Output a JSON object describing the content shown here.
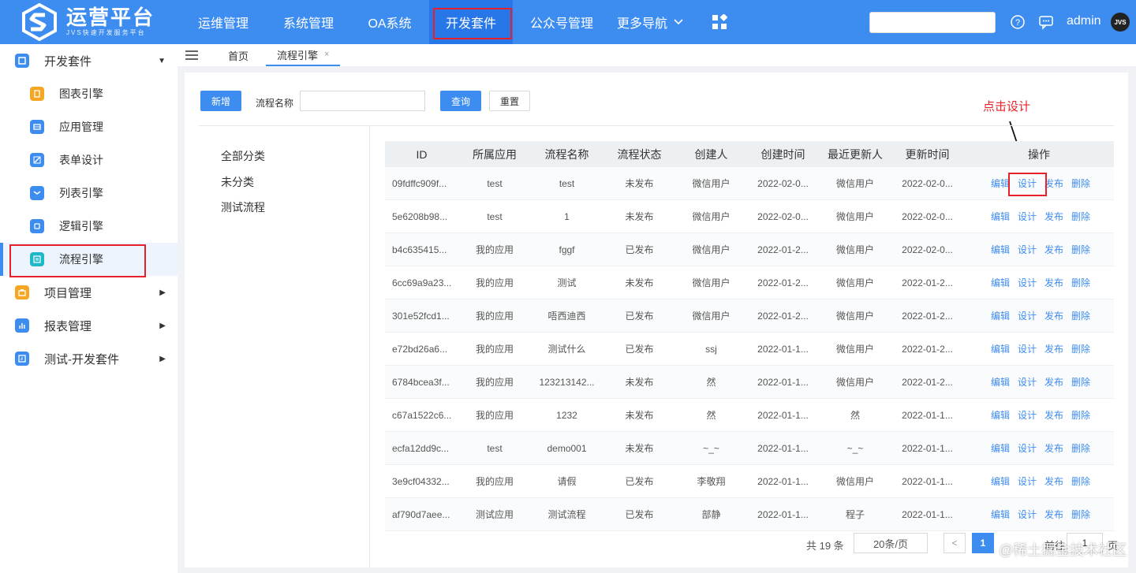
{
  "brand": {
    "title": "运营平台",
    "subtitle": "JVS快速开发服务平台",
    "logo_icon": "hexagon-s-logo"
  },
  "nav": {
    "items": [
      {
        "label": "运维管理"
      },
      {
        "label": "系统管理"
      },
      {
        "label": "OA系统"
      },
      {
        "label": "开发套件",
        "active": true
      },
      {
        "label": "公众号管理"
      },
      {
        "label": "更多导航"
      }
    ],
    "grid_icon": "apps-grid-icon",
    "help_icon": "question-circle-icon",
    "message_icon": "chat-icon",
    "username": "admin",
    "avatar_text": "JVS"
  },
  "sidebar": {
    "items": [
      {
        "label": "开发套件",
        "level": "top",
        "icon": "suite-icon",
        "color": "#3d8cf0",
        "expanded": true
      },
      {
        "label": "图表引擎",
        "level": "sub",
        "icon": "chart-doc-icon",
        "color": "#f5a623"
      },
      {
        "label": "应用管理",
        "level": "sub",
        "icon": "app-icon",
        "color": "#3d8cf0"
      },
      {
        "label": "表单设计",
        "level": "sub",
        "icon": "form-icon",
        "color": "#3d8cf0"
      },
      {
        "label": "列表引擎",
        "level": "sub",
        "icon": "list-icon",
        "color": "#3d8cf0"
      },
      {
        "label": "逻辑引擎",
        "level": "sub",
        "icon": "logic-icon",
        "color": "#3d8cf0"
      },
      {
        "label": "流程引擎",
        "level": "sub",
        "icon": "flow-icon",
        "color": "#1fb8c8",
        "selected": true
      },
      {
        "label": "项目管理",
        "level": "top",
        "icon": "project-icon",
        "color": "#f5a623"
      },
      {
        "label": "报表管理",
        "level": "top",
        "icon": "report-icon",
        "color": "#3d8cf0"
      },
      {
        "label": "测试-开发套件",
        "level": "top",
        "icon": "test-suite-icon",
        "color": "#3d8cf0"
      }
    ]
  },
  "tabs": [
    {
      "label": "首页"
    },
    {
      "label": "流程引擎",
      "active": true,
      "close": "×"
    }
  ],
  "toolbar": {
    "new_label": "新增",
    "field_label": "流程名称",
    "field_value": "",
    "query_label": "查询",
    "reset_label": "重置"
  },
  "categories": [
    "全部分类",
    "未分类",
    "测试流程"
  ],
  "table": {
    "headers": [
      "ID",
      "所属应用",
      "流程名称",
      "流程状态",
      "创建人",
      "创建时间",
      "最近更新人",
      "更新时间",
      "操作"
    ],
    "ops": [
      "编辑",
      "设计",
      "发布",
      "删除"
    ],
    "rows": [
      [
        "09fdffc909f...",
        "test",
        "test",
        "未发布",
        "微信用户",
        "2022-02-0...",
        "微信用户",
        "2022-02-0..."
      ],
      [
        "5e6208b98...",
        "test",
        "1",
        "未发布",
        "微信用户",
        "2022-02-0...",
        "微信用户",
        "2022-02-0..."
      ],
      [
        "b4c635415...",
        "我的应用",
        "fggf",
        "已发布",
        "微信用户",
        "2022-01-2...",
        "微信用户",
        "2022-02-0..."
      ],
      [
        "6cc69a9a23...",
        "我的应用",
        "测试",
        "未发布",
        "微信用户",
        "2022-01-2...",
        "微信用户",
        "2022-01-2..."
      ],
      [
        "301e52fcd1...",
        "我的应用",
        "唔西迪西",
        "已发布",
        "微信用户",
        "2022-01-2...",
        "微信用户",
        "2022-01-2..."
      ],
      [
        "e72bd26a6...",
        "我的应用",
        "测试什么",
        "已发布",
        "ssj",
        "2022-01-1...",
        "微信用户",
        "2022-01-2..."
      ],
      [
        "6784bcea3f...",
        "我的应用",
        "123213142...",
        "未发布",
        "然",
        "2022-01-1...",
        "微信用户",
        "2022-01-2..."
      ],
      [
        "c67a1522c6...",
        "我的应用",
        "1232",
        "未发布",
        "然",
        "2022-01-1...",
        "然",
        "2022-01-1..."
      ],
      [
        "ecfa12dd9c...",
        "test",
        "demo001",
        "未发布",
        "~_~",
        "2022-01-1...",
        "~_~",
        "2022-01-1..."
      ],
      [
        "3e9cf04332...",
        "我的应用",
        "请假",
        "已发布",
        "李敬翔",
        "2022-01-1...",
        "微信用户",
        "2022-01-1..."
      ],
      [
        "af790d7aee...",
        "测试应用",
        "测试流程",
        "已发布",
        "部静",
        "2022-01-1...",
        "程子",
        "2022-01-1..."
      ]
    ]
  },
  "annotation": {
    "text": "点击设计"
  },
  "pagination": {
    "total": "共 19 条",
    "page_size": "20条/页",
    "prev": "<",
    "current": "1",
    "goto_label": "前往",
    "goto_value": "1",
    "suffix": "页"
  },
  "watermark": "@稀土掘金技术社区"
}
